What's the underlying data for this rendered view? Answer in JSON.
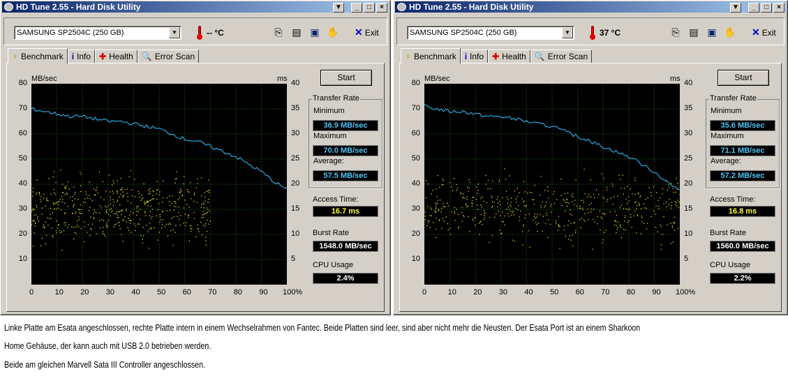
{
  "windows": [
    {
      "title": "HD Tune 2.55 - Hard Disk Utility",
      "drive": "SAMSUNG SP2504C (250 GB)",
      "temperature": "-- °C",
      "exit_label": "Exit",
      "tabs": [
        "Benchmark",
        "Info",
        "Health",
        "Error Scan"
      ],
      "start_label": "Start",
      "left_unit": "MB/sec",
      "right_unit": "ms",
      "transfer_rate_label": "Transfer Rate",
      "minimum_label": "Minimum",
      "minimum": "36.9 MB/sec",
      "maximum_label": "Maximum",
      "maximum": "70.0 MB/sec",
      "average_label": "Average:",
      "average": "57.5 MB/sec",
      "access_time_label": "Access Time:",
      "access_time": "16.7 ms",
      "burst_rate_label": "Burst Rate",
      "burst_rate": "1548.0 MB/sec",
      "cpu_usage_label": "CPU Usage",
      "cpu_usage": "2.4%"
    },
    {
      "title": "HD Tune 2.55 - Hard Disk Utility",
      "drive": "SAMSUNG SP2504C (250 GB)",
      "temperature": "37 °C",
      "exit_label": "Exit",
      "tabs": [
        "Benchmark",
        "Info",
        "Health",
        "Error Scan"
      ],
      "start_label": "Start",
      "left_unit": "MB/sec",
      "right_unit": "ms",
      "transfer_rate_label": "Transfer Rate",
      "minimum_label": "Minimum",
      "minimum": "35.6 MB/sec",
      "maximum_label": "Maximum",
      "maximum": "71.1 MB/sec",
      "average_label": "Average:",
      "average": "57.2 MB/sec",
      "access_time_label": "Access Time:",
      "access_time": "16.8 ms",
      "burst_rate_label": "Burst Rate",
      "burst_rate": "1560.0 MB/sec",
      "cpu_usage_label": "CPU Usage",
      "cpu_usage": "2.2%"
    }
  ],
  "axes": {
    "left_ticks": [
      "80",
      "70",
      "60",
      "50",
      "40",
      "30",
      "20",
      "10"
    ],
    "right_ticks": [
      "40",
      "35",
      "30",
      "25",
      "20",
      "15",
      "10",
      "5"
    ],
    "x_ticks": [
      "0",
      "10",
      "20",
      "30",
      "40",
      "50",
      "60",
      "70",
      "80",
      "90",
      "100%"
    ]
  },
  "colors": {
    "transfer_line": "#2aa7e0",
    "access_dots": "#e0e020",
    "grid": "#1e6b1e"
  },
  "icons": [
    "thermometer-icon",
    "copy-icon",
    "copy-text-icon",
    "save-icon",
    "options-icon",
    "exit-icon",
    "benchmark-tab-icon",
    "info-tab-icon",
    "health-tab-icon",
    "error-scan-tab-icon"
  ],
  "chart_data": [
    {
      "type": "line",
      "x": [
        0,
        5,
        10,
        15,
        20,
        25,
        30,
        35,
        40,
        45,
        50,
        55,
        60,
        65,
        70,
        75,
        80,
        85,
        90,
        95,
        100
      ],
      "series": [
        {
          "name": "Transfer Rate",
          "axis": "MB/sec",
          "values": [
            70,
            69,
            68,
            67,
            67,
            66,
            65,
            65,
            64,
            63,
            62,
            60,
            58,
            57,
            55,
            53,
            51,
            48,
            45,
            41,
            38
          ]
        }
      ],
      "scatter": {
        "name": "Access Time",
        "axis": "ms",
        "range_ms": [
          6,
          25
        ],
        "x_range": [
          0,
          70
        ]
      },
      "ylim_left": [
        0,
        80
      ],
      "ylim_right": [
        0,
        40
      ],
      "xlim": [
        0,
        100
      ]
    },
    {
      "type": "line",
      "x": [
        0,
        5,
        10,
        15,
        20,
        25,
        30,
        35,
        40,
        45,
        50,
        55,
        60,
        65,
        70,
        75,
        80,
        85,
        90,
        95,
        100
      ],
      "series": [
        {
          "name": "Transfer Rate",
          "axis": "MB/sec",
          "values": [
            71,
            70,
            69,
            69,
            68,
            67,
            67,
            66,
            65,
            64,
            63,
            61,
            59,
            57,
            55,
            53,
            51,
            48,
            45,
            41,
            37
          ]
        }
      ],
      "scatter": {
        "name": "Access Time",
        "axis": "ms",
        "range_ms": [
          6,
          25
        ],
        "x_range": [
          0,
          100
        ]
      },
      "ylim_left": [
        0,
        80
      ],
      "ylim_right": [
        0,
        40
      ],
      "xlim": [
        0,
        100
      ]
    }
  ],
  "caption": [
    "Linke Platte am Esata angeschlossen, rechte Platte intern in einem Wechselrahmen von Fantec. Beide Platten sind leer, sind aber nicht mehr die Neusten. Der Esata Port ist an einem Sharkoon",
    "Home Gehäuse, der kann auch mit USB 2.0 betrieben werden.",
    "Beide am gleichen Marvell Sata III Controller angeschlossen."
  ]
}
